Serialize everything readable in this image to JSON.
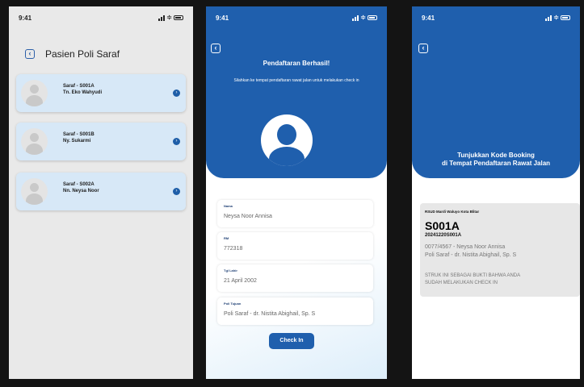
{
  "list_screen": {
    "status_time": "9:41",
    "title": "Pasien Poli Saraf",
    "patients": [
      {
        "code": "Saraf - S001A",
        "name": "Tn. Eko Wahyudi"
      },
      {
        "code": "Saraf - S001B",
        "name": "Ny. Sukarmi"
      },
      {
        "code": "Saraf - S002A",
        "name": "Nn. Neysa Noor"
      }
    ]
  },
  "registration_screen": {
    "status_time": "9:41",
    "title": "Pendaftaran Berhasil!",
    "subtitle": "Silahkan ke tempat pendaftaran rawat jalan untuk melakukan check in",
    "fields": [
      {
        "label": "Nama",
        "value": "Neysa Noor Annisa"
      },
      {
        "label": "RM",
        "value": "772318"
      },
      {
        "label": "Tgl Lahir",
        "value": "21 April 2002"
      },
      {
        "label": "Poli Tujuan",
        "value": "Poli Saraf - dr. Nistita Abighail, Sp. S"
      }
    ],
    "button_label": "Check In"
  },
  "booking_screen": {
    "status_time": "9:41",
    "instruction_line1": "Tunjukkan Kode Booking",
    "instruction_line2": "di Tempat Pendaftaran Rawat Jalan",
    "hospital": "RSUD Mardi Waluyo Kota Blitar",
    "booking_code": "S001A",
    "booking_number": "20241220S001A",
    "patient_line1": "0077/4567 - Neysa Noor Annisa",
    "patient_line2": "Poli Saraf - dr. Nistita Abighail, Sp. S",
    "note_line1": "STRUK INI SEBAGAI BUKTI BAHWA ANDA",
    "note_line2": "SUDAH MELAKUKAN CHECK IN"
  },
  "colors": {
    "primary": "#1f5fad",
    "card": "#d7e8f7",
    "list_bg": "#e9e9e9"
  }
}
